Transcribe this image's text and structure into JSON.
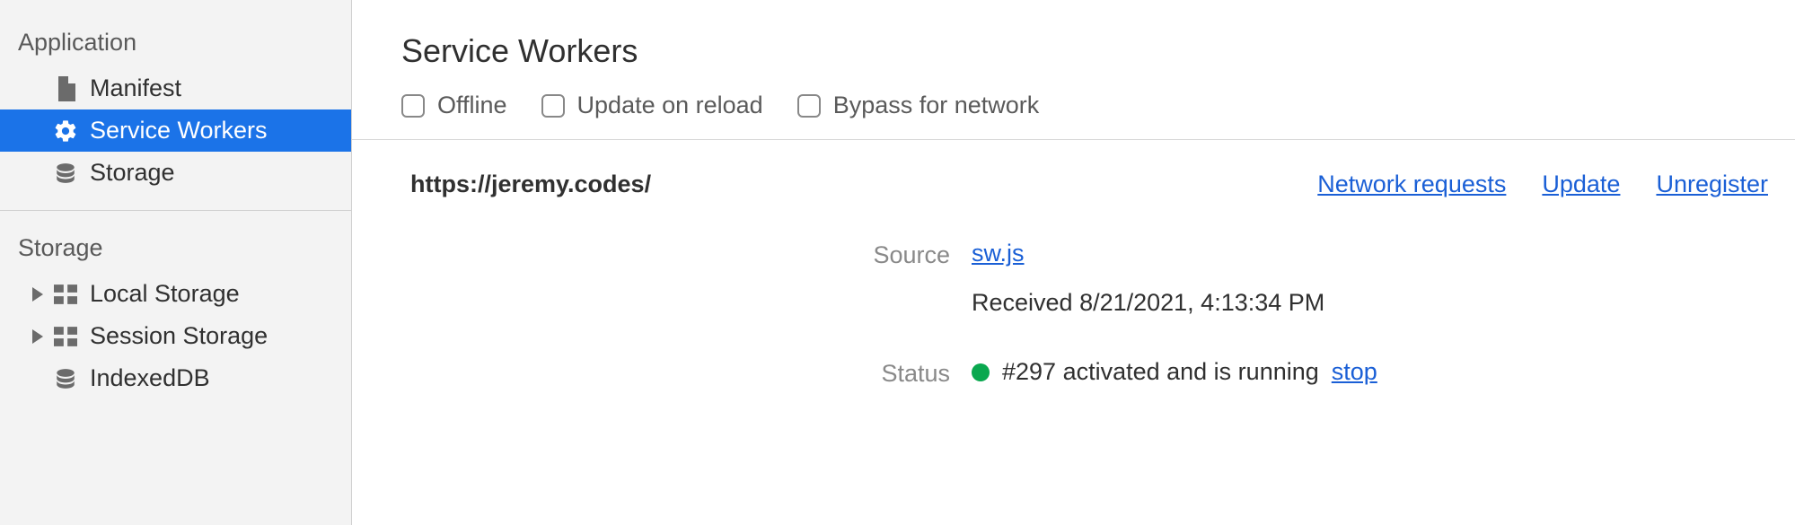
{
  "sidebar": {
    "sections": {
      "application": {
        "title": "Application",
        "items": [
          {
            "label": "Manifest"
          },
          {
            "label": "Service Workers"
          },
          {
            "label": "Storage"
          }
        ]
      },
      "storage": {
        "title": "Storage",
        "items": [
          {
            "label": "Local Storage"
          },
          {
            "label": "Session Storage"
          },
          {
            "label": "IndexedDB"
          }
        ]
      }
    }
  },
  "main": {
    "title": "Service Workers",
    "options": {
      "offline": "Offline",
      "update_on_reload": "Update on reload",
      "bypass_for_network": "Bypass for network"
    },
    "sw": {
      "origin": "https://jeremy.codes/",
      "links": {
        "network_requests": "Network requests",
        "update": "Update",
        "unregister": "Unregister"
      },
      "source": {
        "label": "Source",
        "file": "sw.js",
        "received": "Received 8/21/2021, 4:13:34 PM"
      },
      "status": {
        "label": "Status",
        "text": "#297 activated and is running",
        "stop": "stop"
      }
    }
  }
}
